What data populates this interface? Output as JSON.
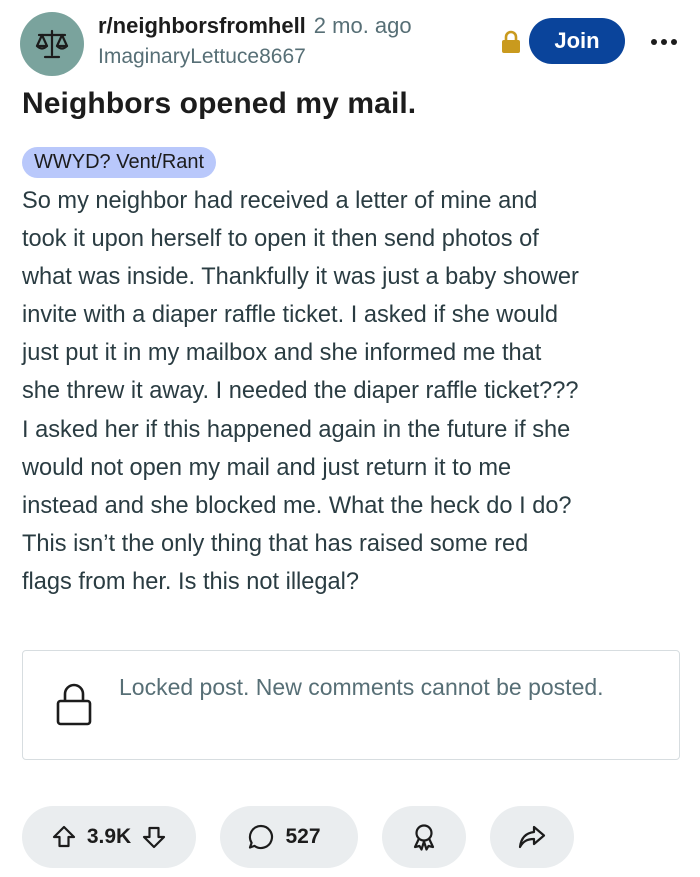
{
  "post": {
    "subreddit": "r/neighborsfromhell",
    "time_ago": "2 mo. ago",
    "author": "ImaginaryLettuce8667",
    "join_label": "Join",
    "title": "Neighbors opened my mail.",
    "flair": "WWYD? Vent/Rant",
    "body_lines": [
      "So my neighbor had received a letter of mine and",
      "took it upon herself to open it then send photos of",
      "what was inside. Thankfully it was just a baby shower",
      "invite with a diaper raffle ticket. I asked if she would",
      "just put it in my mailbox and she informed me that",
      "she threw it away. I needed the diaper raffle ticket???",
      "I asked her if this happened again in the future if she",
      "would not open my mail and just return it to me",
      "instead and she blocked me. What the heck do I do?",
      "This isn’t the only thing that has raised some red",
      "flags from her. Is this not illegal?"
    ],
    "locked_message": "Locked post. New comments cannot be posted."
  },
  "actions": {
    "votes": "3.9K",
    "comments": "527"
  },
  "icons": {
    "avatar": "scales-icon",
    "locked_badge": "lock-icon",
    "more": "more-options-icon",
    "locked_box": "lock-outline-icon",
    "upvote": "upvote-arrow-icon",
    "downvote": "downvote-arrow-icon",
    "comment": "comment-bubble-icon",
    "award": "award-icon",
    "share": "share-arrow-icon"
  },
  "colors": {
    "join_button": "#0a449b",
    "avatar_bg": "#7aa39d",
    "flair_bg": "#b9c8fb",
    "lock_badge": "#c99a1e",
    "pill_bg": "#eaedef",
    "muted_text": "#576f76"
  }
}
